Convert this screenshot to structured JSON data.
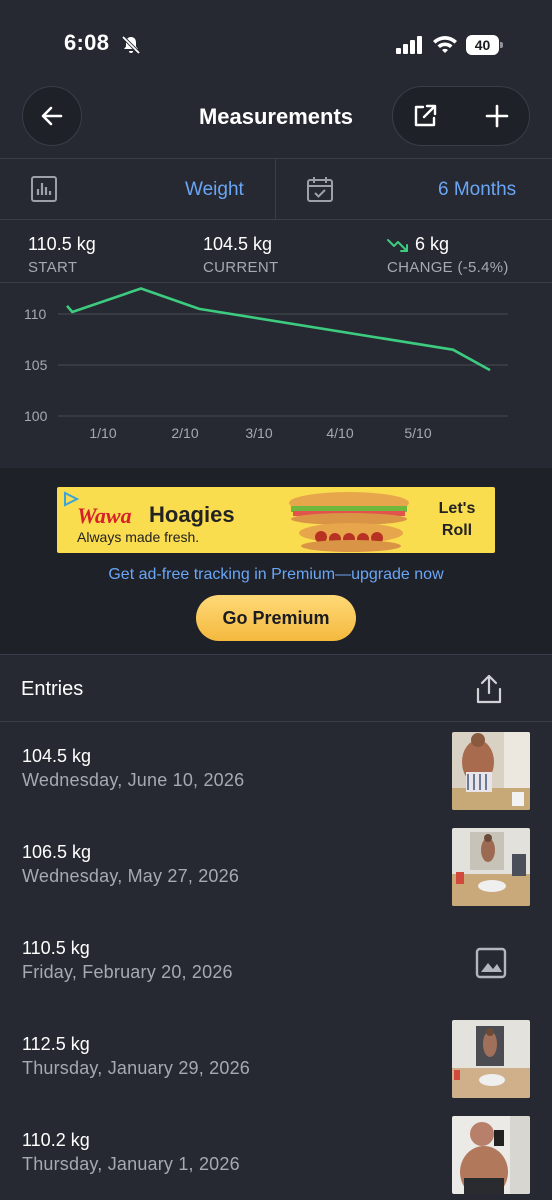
{
  "status_bar": {
    "time": "6:08",
    "battery": "40"
  },
  "nav": {
    "title": "Measurements"
  },
  "selector": {
    "metric": "Weight",
    "range": "6 Months"
  },
  "stats": [
    {
      "value": "110.5 kg",
      "label": "START"
    },
    {
      "value": "104.5 kg",
      "label": "CURRENT"
    },
    {
      "value": "6 kg",
      "label": "CHANGE (-5.4%)"
    }
  ],
  "colors": {
    "accent": "#6aa6f5",
    "line": "#3ccb7f",
    "premium": "#f7c54f",
    "background": "#262932"
  },
  "chart_data": {
    "type": "line",
    "series": [
      {
        "x": [
          "2026-01-01",
          "2026-01-03",
          "2026-01-29",
          "2026-02-20",
          "2026-05-27",
          "2026-06-10"
        ],
        "values": [
          110.8,
          110.2,
          112.5,
          110.5,
          106.5,
          104.5
        ]
      }
    ],
    "x_tick_labels": [
      "1/10",
      "2/10",
      "3/10",
      "4/10",
      "5/10"
    ],
    "y_tick_labels": [
      "110",
      "105",
      "100"
    ],
    "ylim": [
      100,
      112.5
    ],
    "grid": true
  },
  "ad": {
    "brand": "Wawa",
    "title": "Hoagies",
    "subtitle": "Always made fresh.",
    "cta": "Let's Roll",
    "upgrade_text": "Get ad-free tracking in Premium—upgrade now",
    "button": "Go Premium"
  },
  "entries_header": {
    "title": "Entries"
  },
  "entries": [
    {
      "value": "104.5 kg",
      "date": "Wednesday, June 10, 2026",
      "has_photo": true
    },
    {
      "value": "106.5 kg",
      "date": "Wednesday, May 27, 2026",
      "has_photo": true
    },
    {
      "value": "110.5 kg",
      "date": "Friday, February 20, 2026",
      "has_photo": false
    },
    {
      "value": "112.5 kg",
      "date": "Thursday, January 29, 2026",
      "has_photo": true
    },
    {
      "value": "110.2 kg",
      "date": "Thursday, January 1, 2026",
      "has_photo": true
    }
  ]
}
